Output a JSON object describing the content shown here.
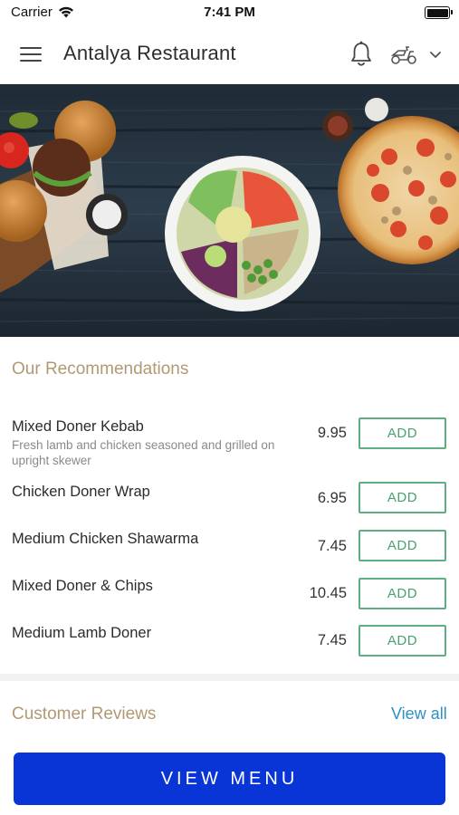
{
  "status_bar": {
    "carrier": "Carrier",
    "time": "7:41 PM"
  },
  "header": {
    "title": "Antalya Restaurant"
  },
  "recommendations": {
    "title": "Our Recommendations",
    "add_label": "ADD",
    "items": [
      {
        "name": "Mixed Doner Kebab",
        "description": "Fresh lamb and chicken seasoned and grilled on upright skewer",
        "price": "9.95"
      },
      {
        "name": "Chicken Doner Wrap",
        "description": "",
        "price": "6.95"
      },
      {
        "name": "Medium Chicken Shawarma",
        "description": "",
        "price": "7.45"
      },
      {
        "name": "Mixed Doner & Chips",
        "description": "",
        "price": "10.45"
      },
      {
        "name": "Medium Lamb Doner",
        "description": "",
        "price": "7.45"
      }
    ]
  },
  "reviews": {
    "title": "Customer Reviews",
    "view_all": "View all"
  },
  "footer": {
    "view_menu": "VIEW MENU"
  },
  "colors": {
    "accent_gold": "#b09a73",
    "add_green": "#4ba06f",
    "link_blue": "#2d8fc4",
    "primary_button": "#0a35d6"
  }
}
